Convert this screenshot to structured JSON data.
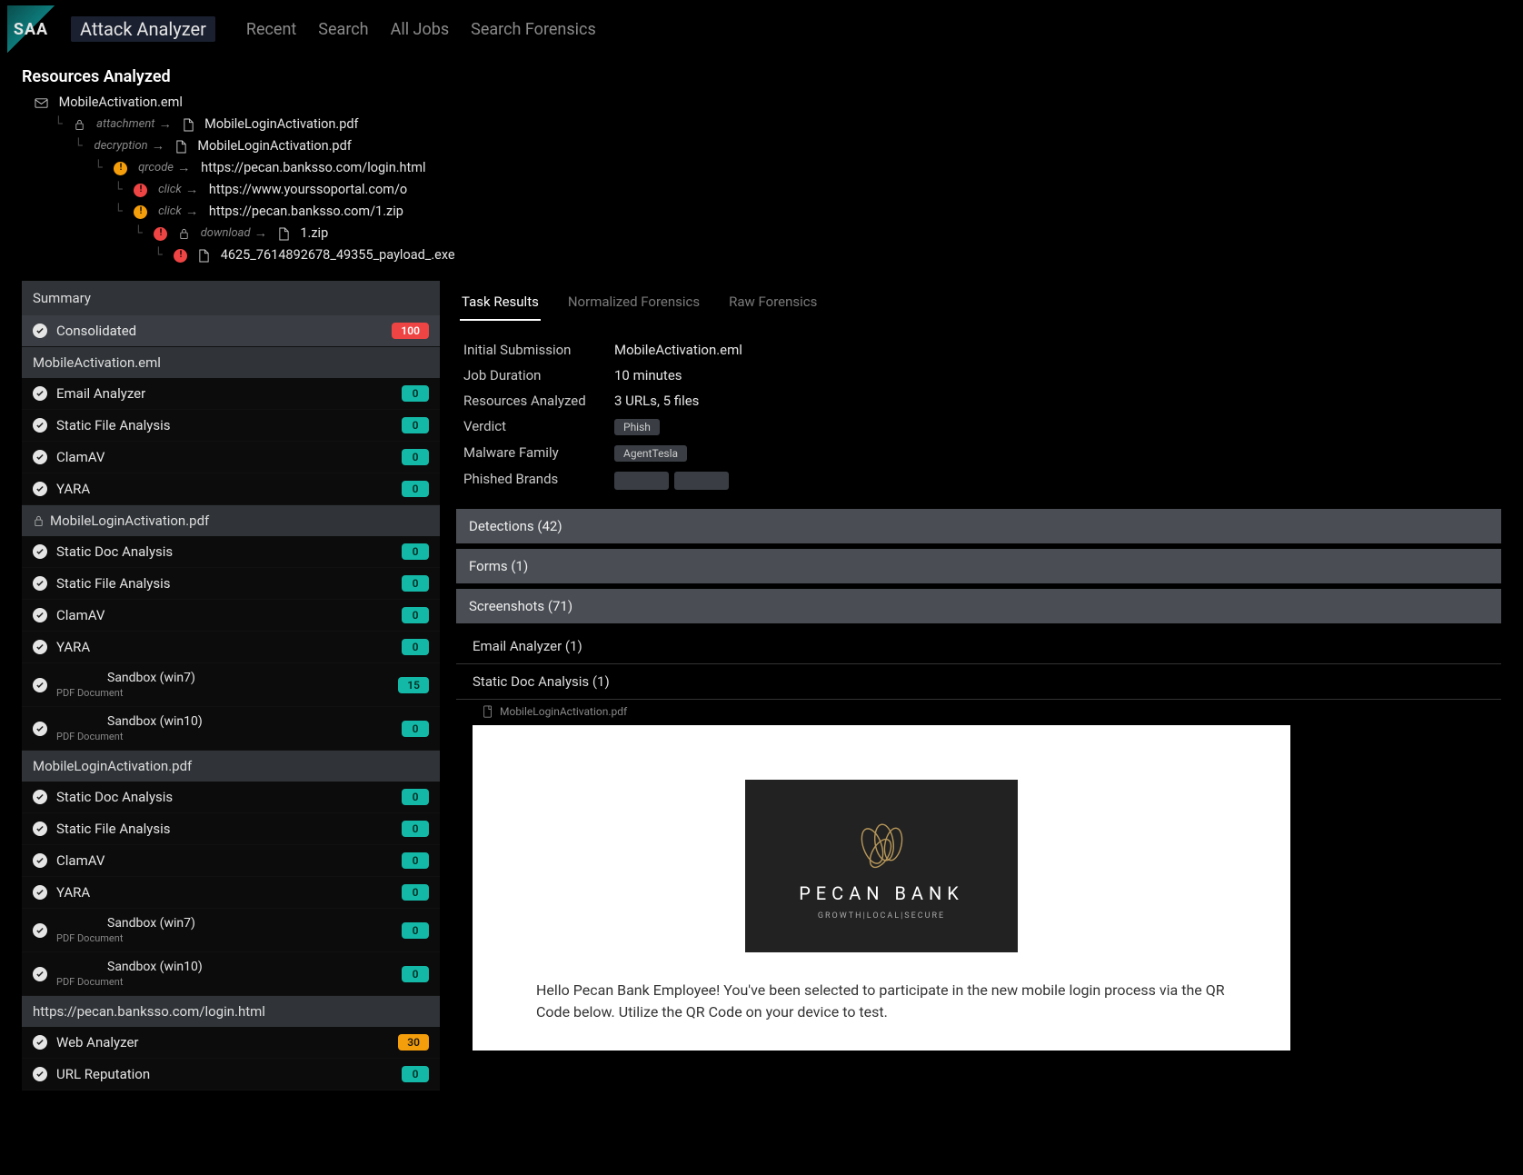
{
  "header": {
    "logo_text": "SAA",
    "app_name": "Attack Analyzer",
    "nav": [
      "Recent",
      "Search",
      "All Jobs",
      "Search Forensics"
    ]
  },
  "tree": {
    "title": "Resources Analyzed",
    "nodes": [
      {
        "indent": 0,
        "icon": "mail",
        "label": "MobileActivation.eml"
      },
      {
        "indent": 1,
        "type": "attachment",
        "icon": "file",
        "label": "MobileLoginActivation.pdf"
      },
      {
        "indent": 2,
        "type": "decryption",
        "icon": "file",
        "label": "MobileLoginActivation.pdf"
      },
      {
        "indent": 3,
        "status": "orange",
        "type": "qrcode",
        "label": "https://pecan.banksso.com/login.html"
      },
      {
        "indent": 4,
        "status": "red",
        "type": "click",
        "label": "https://www.yourssoportal.com/o"
      },
      {
        "indent": 4,
        "status": "orange",
        "type": "click",
        "label": "https://pecan.banksso.com/1.zip"
      },
      {
        "indent": 5,
        "status": "red",
        "type": "download",
        "icon": "file",
        "label": "1.zip"
      },
      {
        "indent": 6,
        "status": "red",
        "icon": "file",
        "label": "4625_7614892678_49355_payload_.exe"
      }
    ]
  },
  "summary": {
    "title": "Summary",
    "consolidated": {
      "label": "Consolidated",
      "badge": 100,
      "badgeColor": "red"
    },
    "groups": [
      {
        "header": "MobileActivation.eml",
        "icon": null,
        "items": [
          {
            "label": "Email Analyzer",
            "badge": 0,
            "bc": "teal"
          },
          {
            "label": "Static File Analysis",
            "badge": 0,
            "bc": "teal"
          },
          {
            "label": "ClamAV",
            "badge": 0,
            "bc": "teal"
          },
          {
            "label": "YARA",
            "badge": 0,
            "bc": "teal"
          }
        ]
      },
      {
        "header": "MobileLoginActivation.pdf",
        "icon": "lock",
        "items": [
          {
            "label": "Static Doc Analysis",
            "badge": 0,
            "bc": "teal"
          },
          {
            "label": "Static File Analysis",
            "badge": 0,
            "bc": "teal"
          },
          {
            "label": "ClamAV",
            "badge": 0,
            "bc": "teal"
          },
          {
            "label": "YARA",
            "badge": 0,
            "bc": "teal"
          },
          {
            "label": "Sandbox (win7)",
            "sub": "PDF Document",
            "badge": 15,
            "bc": "teal"
          },
          {
            "label": "Sandbox (win10)",
            "sub": "PDF Document",
            "badge": 0,
            "bc": "teal"
          }
        ]
      },
      {
        "header": "MobileLoginActivation.pdf",
        "icon": null,
        "items": [
          {
            "label": "Static Doc Analysis",
            "badge": 0,
            "bc": "teal"
          },
          {
            "label": "Static File Analysis",
            "badge": 0,
            "bc": "teal"
          },
          {
            "label": "ClamAV",
            "badge": 0,
            "bc": "teal"
          },
          {
            "label": "YARA",
            "badge": 0,
            "bc": "teal"
          },
          {
            "label": "Sandbox (win7)",
            "sub": "PDF Document",
            "badge": 0,
            "bc": "teal"
          },
          {
            "label": "Sandbox (win10)",
            "sub": "PDF Document",
            "badge": 0,
            "bc": "teal"
          }
        ]
      },
      {
        "header": "https://pecan.banksso.com/login.html",
        "icon": null,
        "items": [
          {
            "label": "Web Analyzer",
            "badge": 30,
            "bc": "orange"
          },
          {
            "label": "URL Reputation",
            "badge": 0,
            "bc": "teal"
          }
        ]
      }
    ]
  },
  "content": {
    "tabs": [
      "Task Results",
      "Normalized Forensics",
      "Raw Forensics"
    ],
    "active_tab": 0,
    "meta": [
      {
        "k": "Initial Submission",
        "v": "MobileActivation.eml"
      },
      {
        "k": "Job Duration",
        "v": "10 minutes"
      },
      {
        "k": "Resources Analyzed",
        "v": "3 URLs, 5 files"
      },
      {
        "k": "Verdict",
        "chips": [
          "Phish"
        ]
      },
      {
        "k": "Malware Family",
        "chips": [
          "AgentTesla"
        ]
      },
      {
        "k": "Phished Brands",
        "redacted": 2
      }
    ],
    "accordions": [
      {
        "label": "Detections (42)"
      },
      {
        "label": "Forms (1)"
      },
      {
        "label": "Screenshots (71)",
        "open": true
      }
    ],
    "screenshot_subsections": [
      {
        "label": "Email Analyzer (1)"
      },
      {
        "label": "Static Doc Analysis (1)"
      }
    ],
    "resource_label": "MobileLoginActivation.pdf",
    "doc_preview": {
      "brand": "PECAN BANK",
      "tagline": "GROWTH|LOCAL|SECURE",
      "body": "Hello Pecan Bank Employee! You've been selected to participate in the new mobile login process via the QR Code below.  Utilize the QR Code on your device to test."
    }
  }
}
